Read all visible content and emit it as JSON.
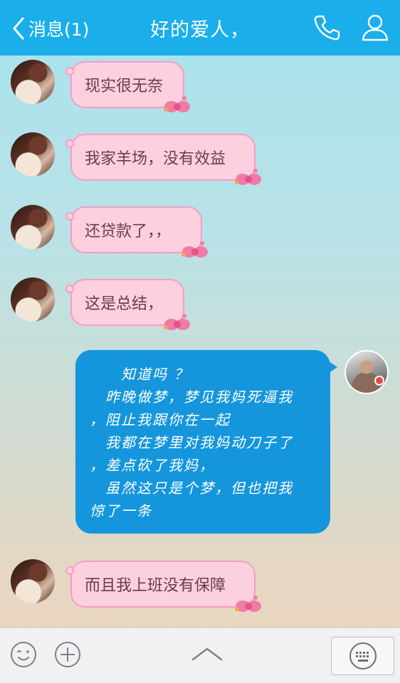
{
  "header": {
    "back_label": "消息(1)",
    "title": "好的爱人，",
    "bg_color": "#1aaeea"
  },
  "messages": [
    {
      "sender": "other",
      "text": "现实很无奈"
    },
    {
      "sender": "other",
      "text": "我家羊场，没有效益"
    },
    {
      "sender": "other",
      "text": "还贷款了，，"
    },
    {
      "sender": "other",
      "text": "这是总结，"
    },
    {
      "sender": "me",
      "lines": [
        "　　知道吗 ？",
        "　昨晚做梦，梦见我妈死逼我",
        "，阻止我跟你在一起",
        "　我都在梦里对我妈动刀子了",
        "，差点砍了我妈，",
        "　虽然这只是个梦，但也把我",
        "惊了一条"
      ]
    },
    {
      "sender": "other",
      "text": "而且我上班没有保障"
    }
  ],
  "icons": {
    "back": "chevron-left-icon",
    "phone": "phone-icon",
    "profile": "person-icon",
    "emoji": "smiley-icon",
    "plus": "plus-icon",
    "expand": "chevron-up-icon",
    "keyboard": "keyboard-icon"
  },
  "colors": {
    "pink_bubble": "#fdd0df",
    "pink_border": "#f59ec0",
    "blue_bubble": "#1596dc"
  }
}
